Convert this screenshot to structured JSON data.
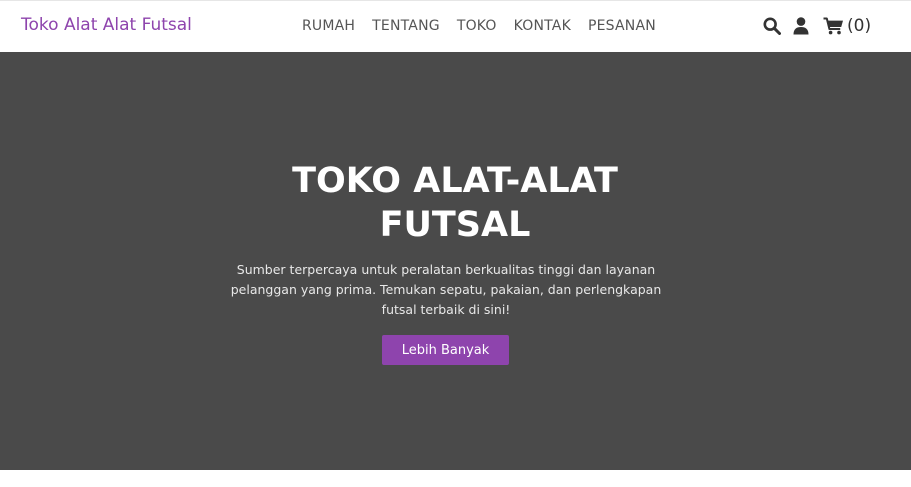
{
  "header": {
    "brand": "Toko Alat Alat Futsal",
    "nav": [
      {
        "label": "RUMAH"
      },
      {
        "label": "TENTANG"
      },
      {
        "label": "TOKO"
      },
      {
        "label": "KONTAK"
      },
      {
        "label": "PESANAN"
      }
    ],
    "actions": {
      "search_icon": "search-icon",
      "user_icon": "user-icon",
      "cart_icon": "cart-icon",
      "cart_count": "(0)"
    }
  },
  "hero": {
    "title": "TOKO ALAT-ALAT FUTSAL",
    "description": "Sumber terpercaya untuk peralatan berkualitas tinggi dan layanan pelanggan yang prima. Temukan sepatu, pakaian, dan perlengkapan futsal terbaik di sini!",
    "button_label": "Lebih Banyak"
  },
  "colors": {
    "brand": "#8e44ad",
    "hero_background": "#4a4a4a",
    "nav_text": "#555555",
    "icon": "#333333"
  }
}
